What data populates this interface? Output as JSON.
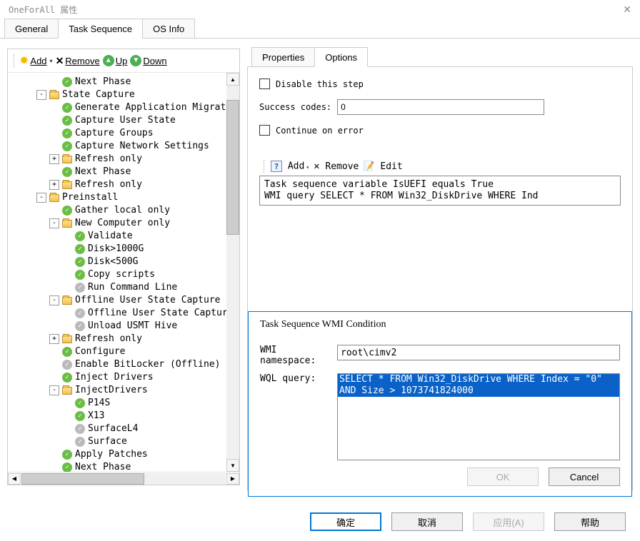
{
  "window_title": "OneForAll 属性",
  "tabs": {
    "general": "General",
    "task_sequence": "Task Sequence",
    "os_info": "OS Info"
  },
  "toolbar": {
    "add": "Add",
    "remove": "Remove",
    "up": "Up",
    "down": "Down"
  },
  "tree": [
    {
      "depth": 2,
      "exp": "",
      "icon": "check",
      "label": "Next Phase"
    },
    {
      "depth": 1,
      "exp": "-",
      "icon": "folder",
      "label": "State Capture"
    },
    {
      "depth": 2,
      "exp": "",
      "icon": "check",
      "label": "Generate Application Migrat"
    },
    {
      "depth": 2,
      "exp": "",
      "icon": "check",
      "label": "Capture User State"
    },
    {
      "depth": 2,
      "exp": "",
      "icon": "check",
      "label": "Capture Groups"
    },
    {
      "depth": 2,
      "exp": "",
      "icon": "check",
      "label": "Capture Network Settings"
    },
    {
      "depth": 2,
      "exp": "+",
      "icon": "folder",
      "label": "Refresh only"
    },
    {
      "depth": 2,
      "exp": "",
      "icon": "check",
      "label": "Next Phase"
    },
    {
      "depth": 2,
      "exp": "+",
      "icon": "folder",
      "label": "Refresh only"
    },
    {
      "depth": 1,
      "exp": "-",
      "icon": "folder",
      "label": "Preinstall"
    },
    {
      "depth": 2,
      "exp": "",
      "icon": "check",
      "label": "Gather local only"
    },
    {
      "depth": 2,
      "exp": "-",
      "icon": "folder",
      "label": "New Computer only"
    },
    {
      "depth": 3,
      "exp": "",
      "icon": "check",
      "label": "Validate"
    },
    {
      "depth": 3,
      "exp": "",
      "icon": "check",
      "label": "Disk>1000G"
    },
    {
      "depth": 3,
      "exp": "",
      "icon": "check",
      "label": "Disk<500G"
    },
    {
      "depth": 3,
      "exp": "",
      "icon": "check",
      "label": "Copy scripts"
    },
    {
      "depth": 3,
      "exp": "",
      "icon": "grey",
      "label": "Run Command Line"
    },
    {
      "depth": 2,
      "exp": "-",
      "icon": "folder",
      "label": "Offline User State Capture"
    },
    {
      "depth": 3,
      "exp": "",
      "icon": "grey",
      "label": "Offline User State Captur"
    },
    {
      "depth": 3,
      "exp": "",
      "icon": "grey",
      "label": "Unload USMT Hive"
    },
    {
      "depth": 2,
      "exp": "+",
      "icon": "folder",
      "label": "Refresh only"
    },
    {
      "depth": 2,
      "exp": "",
      "icon": "check",
      "label": "Configure"
    },
    {
      "depth": 2,
      "exp": "",
      "icon": "grey",
      "label": "Enable BitLocker (Offline)"
    },
    {
      "depth": 2,
      "exp": "",
      "icon": "check",
      "label": "Inject Drivers"
    },
    {
      "depth": 2,
      "exp": "-",
      "icon": "folder",
      "label": "InjectDrivers"
    },
    {
      "depth": 3,
      "exp": "",
      "icon": "check",
      "label": "P14S"
    },
    {
      "depth": 3,
      "exp": "",
      "icon": "check",
      "label": "X13"
    },
    {
      "depth": 3,
      "exp": "",
      "icon": "grey",
      "label": "SurfaceL4"
    },
    {
      "depth": 3,
      "exp": "",
      "icon": "grey",
      "label": "Surface"
    },
    {
      "depth": 2,
      "exp": "",
      "icon": "check",
      "label": "Apply Patches"
    },
    {
      "depth": 2,
      "exp": "",
      "icon": "check",
      "label": "Next Phase"
    }
  ],
  "sub_tabs": {
    "properties": "Properties",
    "options": "Options"
  },
  "options_panel": {
    "disable_label": "Disable this step",
    "success_codes_label": "Success codes:",
    "success_codes_value": "0",
    "continue_label": "Continue on error"
  },
  "cond_toolbar": {
    "add": "Add",
    "remove": "Remove",
    "edit": "Edit"
  },
  "conditions": [
    "Task sequence variable IsUEFI equals True",
    "WMI query SELECT * FROM Win32_DiskDrive WHERE Ind"
  ],
  "dialog": {
    "title": "Task Sequence WMI Condition",
    "namespace_label": "WMI namespace:",
    "namespace_value": "root\\cimv2",
    "wql_label": "WQL query:",
    "wql_value": "SELECT * FROM Win32_DiskDrive WHERE Index = \"0\" AND Size > 1073741824000",
    "ok": "OK",
    "cancel": "Cancel"
  },
  "footer": {
    "ok": "确定",
    "cancel": "取消",
    "apply": "应用(A)",
    "help": "帮助"
  }
}
